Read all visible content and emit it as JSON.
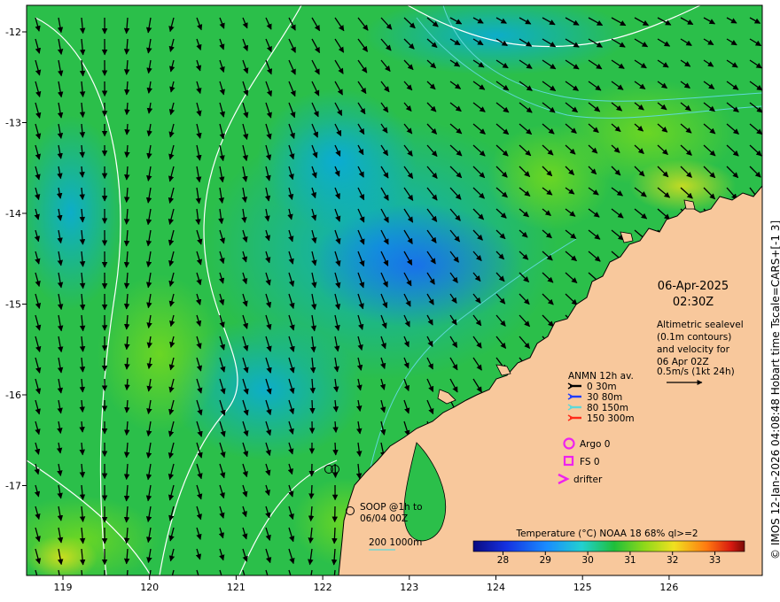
{
  "map": {
    "lon_ticks": [
      "119",
      "120",
      "121",
      "122",
      "123",
      "124",
      "125",
      "126"
    ],
    "lat_ticks": [
      "-12",
      "-13",
      "-14",
      "-15",
      "-16",
      "-17"
    ],
    "colors": {
      "land": "#f8c89c",
      "coast": "#000000",
      "contour": "#ffffff",
      "bathy": "#5fd8d8"
    }
  },
  "info": {
    "date": "06-Apr-2025",
    "time": "02:30Z",
    "alt_line1": "Altimetric sealevel",
    "alt_line2": "(0.1m contours)",
    "alt_line3": "and velocity for",
    "alt_line4": "06 Apr 02Z",
    "scale_label": "0.5m/s (1kt 24h)"
  },
  "anmn": {
    "title": "ANMN 12h av.",
    "items": [
      {
        "label": "0 30m",
        "color": "#000000"
      },
      {
        "label": "30 80m",
        "color": "#1f3cff"
      },
      {
        "label": "80 150m",
        "color": "#5fd8d8"
      },
      {
        "label": "150 300m",
        "color": "#ff2a1a"
      }
    ]
  },
  "markers": {
    "argo": "Argo 0",
    "fs": "FS 0",
    "drifter": "drifter",
    "color": "#ee22ee"
  },
  "soop": {
    "line1": "SOOP @1h to",
    "line2": "06/04 00Z"
  },
  "bathy_label": "200  1000m",
  "colorbar": {
    "title": "Temperature (°C) NOAA 18 68% ql>=2",
    "ticks": [
      "28",
      "29",
      "30",
      "31",
      "32",
      "33"
    ],
    "range": [
      27.3,
      33.7
    ]
  },
  "credit": "© IMOS 12-Jan-2026 04:08:48 Hobart time Tscale=CARS+[-1 3]"
}
